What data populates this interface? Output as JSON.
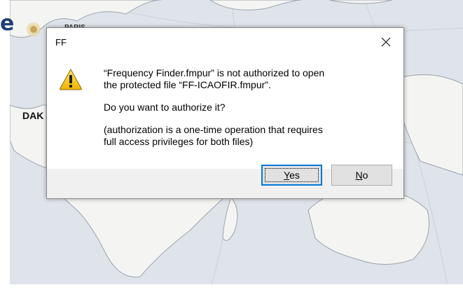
{
  "background": {
    "title_fragment": "e",
    "city_top": "PARIS",
    "city_left": "DAK"
  },
  "dialog": {
    "title": "FF",
    "close_symbol": "×",
    "icon": "warning-icon",
    "message_line1": "“Frequency Finder.fmpur” is not authorized to open",
    "message_line2": "the protected file “FF-ICAOFIR.fmpur”.",
    "question": "Do you want to authorize it?",
    "note_line1": "(authorization is a one-time operation that requires",
    "note_line2": "full access privileges for both files)",
    "yes_button": {
      "mnemonic": "Y",
      "rest": "es"
    },
    "no_button": {
      "mnemonic": "N",
      "rest": "o"
    }
  }
}
